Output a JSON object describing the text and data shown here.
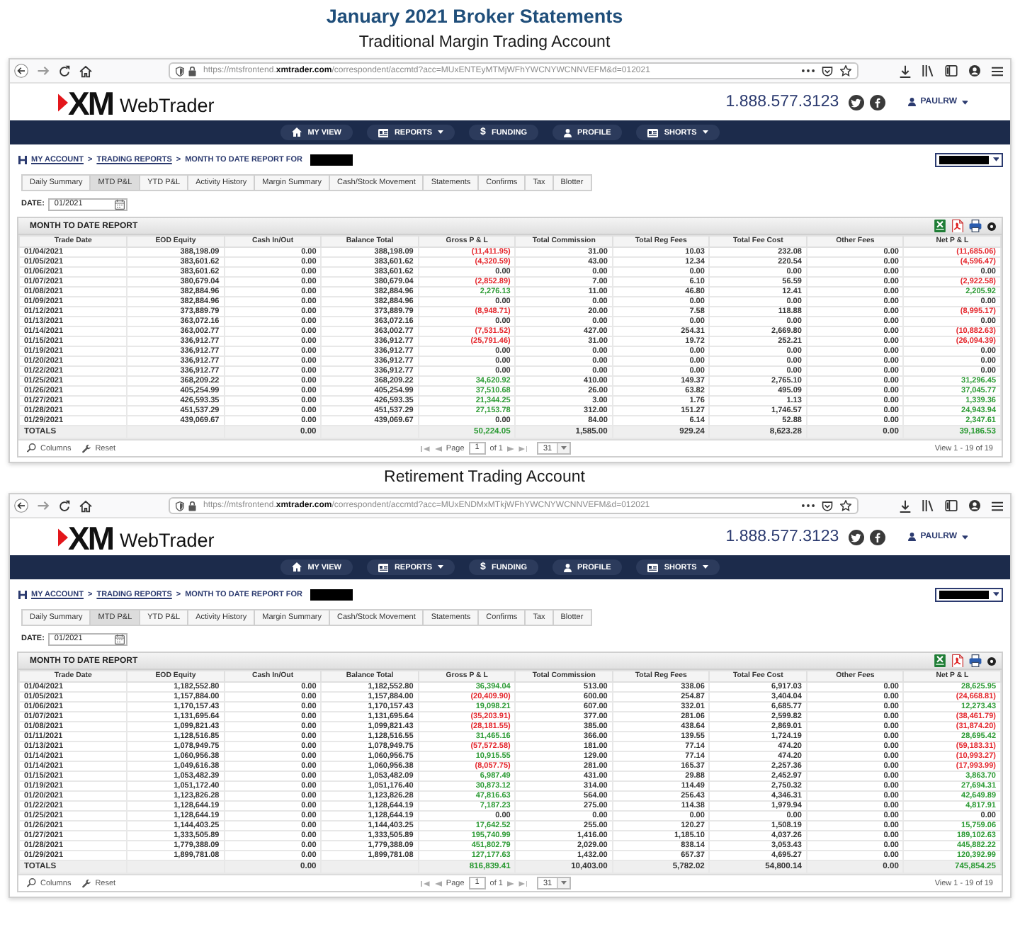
{
  "heading": "January 2021 Broker Statements",
  "accounts": [
    {
      "title": "Traditional Margin Trading Account",
      "browser": {
        "url": "https://mtsfrontend.**xmtrader.com**/correspondent/accmtd?acc=MUxENTEyMTMjWFhYWCNYWCNNVEFM&d=012021"
      },
      "site": {
        "logo_mark": "XM",
        "logo_text": "WebTrader",
        "phone": "1.888.577.3123",
        "user": "PAULRW"
      },
      "nav": [
        {
          "label": "MY VIEW",
          "dropdown": false
        },
        {
          "label": "REPORTS",
          "dropdown": true
        },
        {
          "label": "FUNDING",
          "glyph": "$",
          "dropdown": false
        },
        {
          "label": "PROFILE",
          "dropdown": false
        },
        {
          "label": "SHORTS",
          "dropdown": true
        }
      ],
      "breadcrumb": [
        {
          "kind": "link",
          "text": "MY ACCOUNT"
        },
        {
          "kind": "separator",
          "text": ">"
        },
        {
          "kind": "link",
          "text": "TRADING REPORTS"
        },
        {
          "kind": "separator",
          "text": ">"
        },
        {
          "kind": "label",
          "text": "MONTH TO DATE REPORT FOR"
        }
      ],
      "tabs": [
        {
          "label": "Daily Summary",
          "selected": false
        },
        {
          "label": "MTD P&L",
          "selected": true
        },
        {
          "label": "YTD P&L",
          "selected": false
        },
        {
          "label": "Activity History",
          "selected": false
        },
        {
          "label": "Margin Summary",
          "selected": false
        },
        {
          "label": "Cash/Stock Movement",
          "selected": false
        },
        {
          "label": "Statements",
          "selected": false
        },
        {
          "label": "Confirms",
          "selected": false
        },
        {
          "label": "Tax",
          "selected": false
        },
        {
          "label": "Blotter",
          "selected": false
        }
      ],
      "date": {
        "label": "DATE:",
        "value": "01/2021"
      },
      "report": {
        "title": "MONTH TO DATE REPORT",
        "columns": [
          "Trade Date",
          "EOD Equity",
          "Cash In/Out",
          "Balance Total",
          "Gross P & L",
          "Total Commission",
          "Total Reg Fees",
          "Total Fee Cost",
          "Other Fees",
          "Net P & L"
        ],
        "rows": [
          {
            "cells": [
              "01/04/2021",
              "388,198.09",
              "0.00",
              "388,198.09",
              {
                "text": "(11,411.95)",
                "color": "#e4262c"
              },
              "31.00",
              "10.03",
              "232.08",
              "0.00",
              {
                "text": "(11,685.06)",
                "color": "#e4262c"
              }
            ]
          },
          {
            "cells": [
              "01/05/2021",
              "383,601.62",
              "0.00",
              "383,601.62",
              {
                "text": "(4,320.59)",
                "color": "#e4262c"
              },
              "43.00",
              "12.34",
              "220.54",
              "0.00",
              {
                "text": "(4,596.47)",
                "color": "#e4262c"
              }
            ]
          },
          {
            "cells": [
              "01/06/2021",
              "383,601.62",
              "0.00",
              "383,601.62",
              {
                "text": "0.00",
                "color": "#333333"
              },
              "0.00",
              "0.00",
              "0.00",
              "0.00",
              {
                "text": "0.00",
                "color": "#333333"
              }
            ]
          },
          {
            "cells": [
              "01/07/2021",
              "380,679.04",
              "0.00",
              "380,679.04",
              {
                "text": "(2,852.89)",
                "color": "#e4262c"
              },
              "7.00",
              "6.10",
              "56.59",
              "0.00",
              {
                "text": "(2,922.58)",
                "color": "#e4262c"
              }
            ]
          },
          {
            "cells": [
              "01/08/2021",
              "382,884.96",
              "0.00",
              "382,884.96",
              {
                "text": "2,276.13",
                "color": "#2b9a33"
              },
              "11.00",
              "46.80",
              "12.41",
              "0.00",
              {
                "text": "2,205.92",
                "color": "#2b9a33"
              }
            ]
          },
          {
            "cells": [
              "01/09/2021",
              "382,884.96",
              "0.00",
              "382,884.96",
              {
                "text": "0.00",
                "color": "#333333"
              },
              "0.00",
              "0.00",
              "0.00",
              "0.00",
              {
                "text": "0.00",
                "color": "#333333"
              }
            ]
          },
          {
            "cells": [
              "01/12/2021",
              "373,889.79",
              "0.00",
              "373,889.79",
              {
                "text": "(8,948.71)",
                "color": "#e4262c"
              },
              "20.00",
              "7.58",
              "118.88",
              "0.00",
              {
                "text": "(8,995.17)",
                "color": "#e4262c"
              }
            ]
          },
          {
            "cells": [
              "01/13/2021",
              "363,072.16",
              "0.00",
              "363,072.16",
              {
                "text": "0.00",
                "color": "#333333"
              },
              "0.00",
              "0.00",
              "0.00",
              "0.00",
              {
                "text": "0.00",
                "color": "#333333"
              }
            ]
          },
          {
            "cells": [
              "01/14/2021",
              "363,002.77",
              "0.00",
              "363,002.77",
              {
                "text": "(7,531.52)",
                "color": "#e4262c"
              },
              "427.00",
              "254.31",
              "2,669.80",
              "0.00",
              {
                "text": "(10,882.63)",
                "color": "#e4262c"
              }
            ]
          },
          {
            "cells": [
              "01/15/2021",
              "336,912.77",
              "0.00",
              "336,912.77",
              {
                "text": "(25,791.46)",
                "color": "#e4262c"
              },
              "31.00",
              "19.72",
              "252.21",
              "0.00",
              {
                "text": "(26,094.39)",
                "color": "#e4262c"
              }
            ]
          },
          {
            "cells": [
              "01/19/2021",
              "336,912.77",
              "0.00",
              "336,912.77",
              {
                "text": "0.00",
                "color": "#333333"
              },
              "0.00",
              "0.00",
              "0.00",
              "0.00",
              {
                "text": "0.00",
                "color": "#333333"
              }
            ]
          },
          {
            "cells": [
              "01/20/2021",
              "336,912.77",
              "0.00",
              "336,912.77",
              {
                "text": "0.00",
                "color": "#333333"
              },
              "0.00",
              "0.00",
              "0.00",
              "0.00",
              {
                "text": "0.00",
                "color": "#333333"
              }
            ]
          },
          {
            "cells": [
              "01/22/2021",
              "336,912.77",
              "0.00",
              "336,912.77",
              {
                "text": "0.00",
                "color": "#333333"
              },
              "0.00",
              "0.00",
              "0.00",
              "0.00",
              {
                "text": "0.00",
                "color": "#333333"
              }
            ]
          },
          {
            "cells": [
              "01/25/2021",
              "368,209.22",
              "0.00",
              "368,209.22",
              {
                "text": "34,620.92",
                "color": "#2b9a33"
              },
              "410.00",
              "149.37",
              "2,765.10",
              "0.00",
              {
                "text": "31,296.45",
                "color": "#2b9a33"
              }
            ]
          },
          {
            "cells": [
              "01/26/2021",
              "405,254.99",
              "0.00",
              "405,254.99",
              {
                "text": "37,510.68",
                "color": "#2b9a33"
              },
              "26.00",
              "63.82",
              "495.09",
              "0.00",
              {
                "text": "37,045.77",
                "color": "#2b9a33"
              }
            ]
          },
          {
            "cells": [
              "01/27/2021",
              "426,593.35",
              "0.00",
              "426,593.35",
              {
                "text": "21,344.25",
                "color": "#2b9a33"
              },
              "3.00",
              "1.76",
              "1.13",
              "0.00",
              {
                "text": "1,339.36",
                "color": "#2b9a33"
              }
            ]
          },
          {
            "cells": [
              "01/28/2021",
              "451,537.29",
              "0.00",
              "451,537.29",
              {
                "text": "27,153.78",
                "color": "#2b9a33"
              },
              "312.00",
              "151.27",
              "1,746.57",
              "0.00",
              {
                "text": "24,943.94",
                "color": "#2b9a33"
              }
            ]
          },
          {
            "cells": [
              "01/29/2021",
              "439,069.67",
              "0.00",
              "439,069.67",
              {
                "text": "0.00",
                "color": "#333333"
              },
              "84.00",
              "6.14",
              "52.88",
              "0.00",
              {
                "text": "2,347.61",
                "color": "#2b9a33"
              }
            ]
          }
        ],
        "totals": {
          "label": "TOTALS",
          "cash_in_out": "0.00",
          "gross_pl": {
            "text": "50,224.05",
            "color": "#2b9a33"
          },
          "total_commission": "1,585.00",
          "total_reg_fees": "929.24",
          "total_fee_cost": "8,623.28",
          "other_fees": "0.00",
          "net_pl": {
            "text": "39,186.53",
            "color": "#2b9a33"
          }
        }
      },
      "pager": {
        "columns": "Columns",
        "reset": "Reset",
        "page_label": "Page",
        "page": "1",
        "page_count": "of 1",
        "per_page": "31",
        "summary": "View 1 - 19 of 19"
      }
    },
    {
      "title": "Retirement Trading Account",
      "browser": {
        "url": "https://mtsfrontend.**xmtrader.com**/correspondent/accmtd?acc=MUxENDMxMTkjWFhYWCNYWCNNVEFM&d=012021"
      },
      "site": {
        "logo_mark": "XM",
        "logo_text": "WebTrader",
        "phone": "1.888.577.3123",
        "user": "PAULRW"
      },
      "nav": [
        {
          "label": "MY VIEW",
          "dropdown": false
        },
        {
          "label": "REPORTS",
          "dropdown": true
        },
        {
          "label": "FUNDING",
          "glyph": "$",
          "dropdown": false
        },
        {
          "label": "PROFILE",
          "dropdown": false
        },
        {
          "label": "SHORTS",
          "dropdown": true
        }
      ],
      "breadcrumb": [
        {
          "kind": "link",
          "text": "MY ACCOUNT"
        },
        {
          "kind": "separator",
          "text": ">"
        },
        {
          "kind": "link",
          "text": "TRADING REPORTS"
        },
        {
          "kind": "separator",
          "text": ">"
        },
        {
          "kind": "label",
          "text": "MONTH TO DATE REPORT FOR"
        }
      ],
      "tabs": [
        {
          "label": "Daily Summary",
          "selected": false
        },
        {
          "label": "MTD P&L",
          "selected": true
        },
        {
          "label": "YTD P&L",
          "selected": false
        },
        {
          "label": "Activity History",
          "selected": false
        },
        {
          "label": "Margin Summary",
          "selected": false
        },
        {
          "label": "Cash/Stock Movement",
          "selected": false
        },
        {
          "label": "Statements",
          "selected": false
        },
        {
          "label": "Confirms",
          "selected": false
        },
        {
          "label": "Tax",
          "selected": false
        },
        {
          "label": "Blotter",
          "selected": false
        }
      ],
      "date": {
        "label": "DATE:",
        "value": "01/2021"
      },
      "report": {
        "title": "MONTH TO DATE REPORT",
        "columns": [
          "Trade Date",
          "EOD Equity",
          "Cash In/Out",
          "Balance Total",
          "Gross P & L",
          "Total Commission",
          "Total Reg Fees",
          "Total Fee Cost",
          "Other Fees",
          "Net P & L"
        ],
        "rows": [
          {
            "cells": [
              "01/04/2021",
              "1,182,552.80",
              "0.00",
              "1,182,552.80",
              {
                "text": "36,394.04",
                "color": "#2b9a33"
              },
              "513.00",
              "338.06",
              "6,917.03",
              "0.00",
              {
                "text": "28,625.95",
                "color": "#2b9a33"
              }
            ]
          },
          {
            "cells": [
              "01/05/2021",
              "1,157,884.00",
              "0.00",
              "1,157,884.00",
              {
                "text": "(20,409.90)",
                "color": "#e4262c"
              },
              "600.00",
              "254.87",
              "3,404.04",
              "0.00",
              {
                "text": "(24,668.81)",
                "color": "#e4262c"
              }
            ]
          },
          {
            "cells": [
              "01/06/2021",
              "1,170,157.43",
              "0.00",
              "1,170,157.43",
              {
                "text": "19,098.21",
                "color": "#2b9a33"
              },
              "607.00",
              "332.01",
              "6,685.77",
              "0.00",
              {
                "text": "12,273.43",
                "color": "#2b9a33"
              }
            ]
          },
          {
            "cells": [
              "01/07/2021",
              "1,131,695.64",
              "0.00",
              "1,131,695.64",
              {
                "text": "(35,203.91)",
                "color": "#e4262c"
              },
              "377.00",
              "281.06",
              "2,599.82",
              "0.00",
              {
                "text": "(38,461.79)",
                "color": "#e4262c"
              }
            ]
          },
          {
            "cells": [
              "01/08/2021",
              "1,099,821.43",
              "0.00",
              "1,099,821.43",
              {
                "text": "(28,181.55)",
                "color": "#e4262c"
              },
              "385.00",
              "438.64",
              "2,869.01",
              "0.00",
              {
                "text": "(31,874.20)",
                "color": "#e4262c"
              }
            ]
          },
          {
            "cells": [
              "01/11/2021",
              "1,128,516.85",
              "0.00",
              "1,128,516.55",
              {
                "text": "31,465.16",
                "color": "#2b9a33"
              },
              "366.00",
              "139.55",
              "1,724.19",
              "0.00",
              {
                "text": "28,695.42",
                "color": "#2b9a33"
              }
            ]
          },
          {
            "cells": [
              "01/13/2021",
              "1,078,949.75",
              "0.00",
              "1,078,949.75",
              {
                "text": "(57,572.58)",
                "color": "#e4262c"
              },
              "181.00",
              "77.14",
              "474.20",
              "0.00",
              {
                "text": "(59,183.31)",
                "color": "#e4262c"
              }
            ]
          },
          {
            "cells": [
              "01/14/2021",
              "1,060,956.38",
              "0.00",
              "1,060,956.75",
              {
                "text": "10,915.55",
                "color": "#2b9a33"
              },
              "129.00",
              "77.14",
              "474.20",
              "0.00",
              {
                "text": "(10,993.27)",
                "color": "#e4262c"
              }
            ]
          },
          {
            "cells": [
              "01/14/2021",
              "1,049,616.38",
              "0.00",
              "1,060,956.38",
              {
                "text": "(8,057.75)",
                "color": "#e4262c"
              },
              "281.00",
              "165.37",
              "2,257.36",
              "0.00",
              {
                "text": "(17,993.99)",
                "color": "#e4262c"
              }
            ]
          },
          {
            "cells": [
              "01/15/2021",
              "1,053,482.39",
              "0.00",
              "1,053,482.09",
              {
                "text": "6,987.49",
                "color": "#2b9a33"
              },
              "431.00",
              "29.88",
              "2,452.97",
              "0.00",
              {
                "text": "3,863.70",
                "color": "#2b9a33"
              }
            ]
          },
          {
            "cells": [
              "01/19/2021",
              "1,051,172.40",
              "0.00",
              "1,051,176.40",
              {
                "text": "30,873.12",
                "color": "#2b9a33"
              },
              "314.00",
              "114.49",
              "2,750.32",
              "0.00",
              {
                "text": "27,694.31",
                "color": "#2b9a33"
              }
            ]
          },
          {
            "cells": [
              "01/20/2021",
              "1,123,826.28",
              "0.00",
              "1,123,826.28",
              {
                "text": "47,816.63",
                "color": "#2b9a33"
              },
              "564.00",
              "256.43",
              "4,346.31",
              "0.00",
              {
                "text": "42,649.89",
                "color": "#2b9a33"
              }
            ]
          },
          {
            "cells": [
              "01/22/2021",
              "1,128,644.19",
              "0.00",
              "1,128,644.19",
              {
                "text": "7,187.23",
                "color": "#2b9a33"
              },
              "275.00",
              "114.38",
              "1,979.94",
              "0.00",
              {
                "text": "4,817.91",
                "color": "#2b9a33"
              }
            ]
          },
          {
            "cells": [
              "01/25/2021",
              "1,128,644.19",
              "0.00",
              "1,128,644.19",
              {
                "text": "0.00",
                "color": "#333333"
              },
              "0.00",
              "0.00",
              "0.00",
              "0.00",
              {
                "text": "0.00",
                "color": "#333333"
              }
            ]
          },
          {
            "cells": [
              "01/26/2021",
              "1,144,403.25",
              "0.00",
              "1,144,403.25",
              {
                "text": "17,642.52",
                "color": "#2b9a33"
              },
              "255.00",
              "120.27",
              "1,508.19",
              "0.00",
              {
                "text": "15,759.06",
                "color": "#2b9a33"
              }
            ]
          },
          {
            "cells": [
              "01/27/2021",
              "1,333,505.89",
              "0.00",
              "1,333,505.89",
              {
                "text": "195,740.99",
                "color": "#2b9a33"
              },
              "1,416.00",
              "1,185.10",
              "4,037.26",
              "0.00",
              {
                "text": "189,102.63",
                "color": "#2b9a33"
              }
            ]
          },
          {
            "cells": [
              "01/28/2021",
              "1,779,388.09",
              "0.00",
              "1,779,388.09",
              {
                "text": "451,802.79",
                "color": "#2b9a33"
              },
              "2,029.00",
              "838.14",
              "3,053.43",
              "0.00",
              {
                "text": "445,882.22",
                "color": "#2b9a33"
              }
            ]
          },
          {
            "cells": [
              "01/29/2021",
              "1,899,781.08",
              "0.00",
              "1,899,781.08",
              {
                "text": "127,177.63",
                "color": "#2b9a33"
              },
              "1,432.00",
              "657.37",
              "4,695.27",
              "0.00",
              {
                "text": "120,392.99",
                "color": "#2b9a33"
              }
            ]
          }
        ],
        "totals": {
          "label": "TOTALS",
          "cash_in_out": "0.00",
          "gross_pl": {
            "text": "816,839.41",
            "color": "#2b9a33"
          },
          "total_commission": "10,403.00",
          "total_reg_fees": "5,782.02",
          "total_fee_cost": "54,800.14",
          "other_fees": "0.00",
          "net_pl": {
            "text": "745,854.25",
            "color": "#2b9a33"
          }
        }
      },
      "pager": {
        "columns": "Columns",
        "reset": "Reset",
        "page_label": "Page",
        "page": "1",
        "page_count": "of 1",
        "per_page": "31",
        "summary": "View 1 - 19 of 19"
      }
    }
  ]
}
